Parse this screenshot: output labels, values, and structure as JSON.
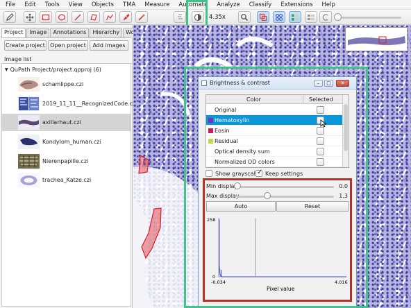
{
  "menu": [
    "File",
    "Edit",
    "Tools",
    "View",
    "Objects",
    "TMA",
    "Measure",
    "Automate",
    "Analyze",
    "Classify",
    "Extensions",
    "Help"
  ],
  "toolbar": {
    "zoom": "4.35x"
  },
  "left_panel": {
    "tabs": [
      "Project",
      "Image",
      "Annotations",
      "Hierarchy",
      "Work",
      "▾"
    ],
    "buttons": [
      "Create project",
      "Open project",
      "Add images"
    ],
    "image_list_label": "Image list",
    "project_root": "QuPath Project/project.qpproj (6)",
    "images": [
      {
        "name": "schamlippe.czi"
      },
      {
        "name": "2019_11_11__RecognizedCode.czi"
      },
      {
        "name": "axillarhaut.czi"
      },
      {
        "name": "Kondylom_human.czi"
      },
      {
        "name": "Nierenpapille.czi"
      },
      {
        "name": "trachea_Katze.czi"
      }
    ]
  },
  "dialog": {
    "title": "Brightness & contrast",
    "col_color": "Color",
    "col_selected": "Selected",
    "channels": [
      {
        "name": "Original",
        "swatch": ""
      },
      {
        "name": "Hematoxylin",
        "swatch": "#7a2fb8"
      },
      {
        "name": "Eosin",
        "swatch": "#c21d5f"
      },
      {
        "name": "Residual",
        "swatch": "#b6e04a"
      },
      {
        "name": "Optical density sum",
        "swatch": ""
      },
      {
        "name": "Normalized OD colors",
        "swatch": ""
      }
    ],
    "show_grayscale": "Show grayscale",
    "keep_settings": "Keep settings",
    "min_label": "Min display",
    "min_value": "0.0",
    "min_fraction": 0.0,
    "max_label": "Max display",
    "max_value": "1.3",
    "max_fraction": 0.31,
    "auto": "Auto",
    "reset": "Reset",
    "histogram": {
      "y_max_label": "258",
      "y_min_label": "0",
      "x_min_label": "-0.034",
      "x_max_label": "4.016",
      "x_axis_label": "Pixel value"
    }
  },
  "colors": {
    "highlight_green": "#3ec48a",
    "highlight_red": "#b13426",
    "selection": "#0b96d7",
    "annotation": "#e0323a"
  }
}
